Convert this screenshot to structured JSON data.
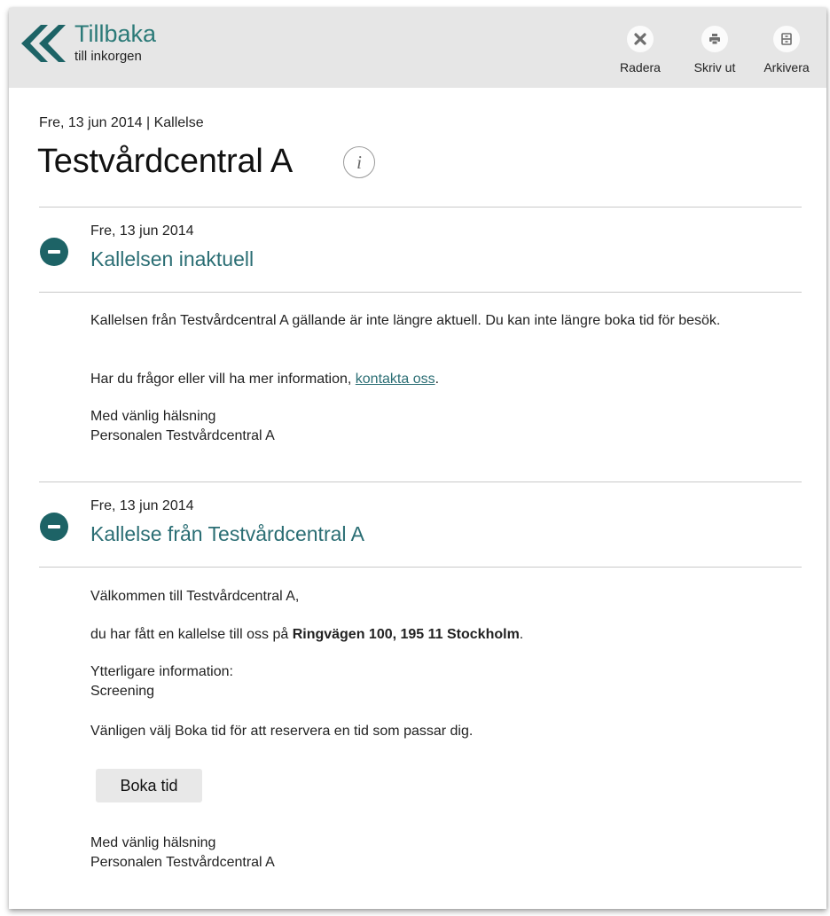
{
  "back": {
    "title": "Tillbaka",
    "subtitle": "till inkorgen"
  },
  "toolbar": {
    "delete_label": "Radera",
    "print_label": "Skriv ut",
    "archive_label": "Arkivera"
  },
  "header": {
    "meta": "Fre, 13 jun 2014 | Kallelse",
    "title": "Testvårdcentral A",
    "info_glyph": "i"
  },
  "sections": [
    {
      "date": "Fre, 13 jun 2014",
      "title": "Kallelsen inaktuell",
      "body": {
        "p1": "Kallelsen från Testvårdcentral A gällande är inte längre aktuell. Du kan inte längre boka tid för besök.",
        "p2_before": "Har du frågor eller vill ha mer information, ",
        "p2_link": "kontakta oss",
        "p2_after": ".",
        "closing_line1": "Med vänlig hälsning",
        "closing_line2": "Personalen Testvårdcentral A"
      }
    },
    {
      "date": "Fre, 13 jun 2014",
      "title": "Kallelse från Testvårdcentral A",
      "body": {
        "greeting": "Välkommen till Testvårdcentral A,",
        "address_before": "du har fått en kallelse till oss på ",
        "address_bold": "Ringvägen 100, 195 11 Stockholm",
        "address_after": ".",
        "info_label": "Ytterligare information:",
        "info_value": "Screening",
        "instruction": "Vänligen välj Boka tid för att reservera en tid som passar dig.",
        "book_button": "Boka tid",
        "closing_line1": "Med vänlig hälsning",
        "closing_line2": "Personalen Testvårdcentral A"
      }
    }
  ],
  "colors": {
    "accent": "#2b7a78",
    "section_icon": "#1d6366",
    "topbar": "#e6e6e6"
  },
  "icons": {
    "back": "double-chevron-left-icon",
    "delete": "close-icon",
    "print": "printer-icon",
    "archive": "archive-icon",
    "info": "info-icon",
    "collapse": "minus-circle-icon"
  }
}
